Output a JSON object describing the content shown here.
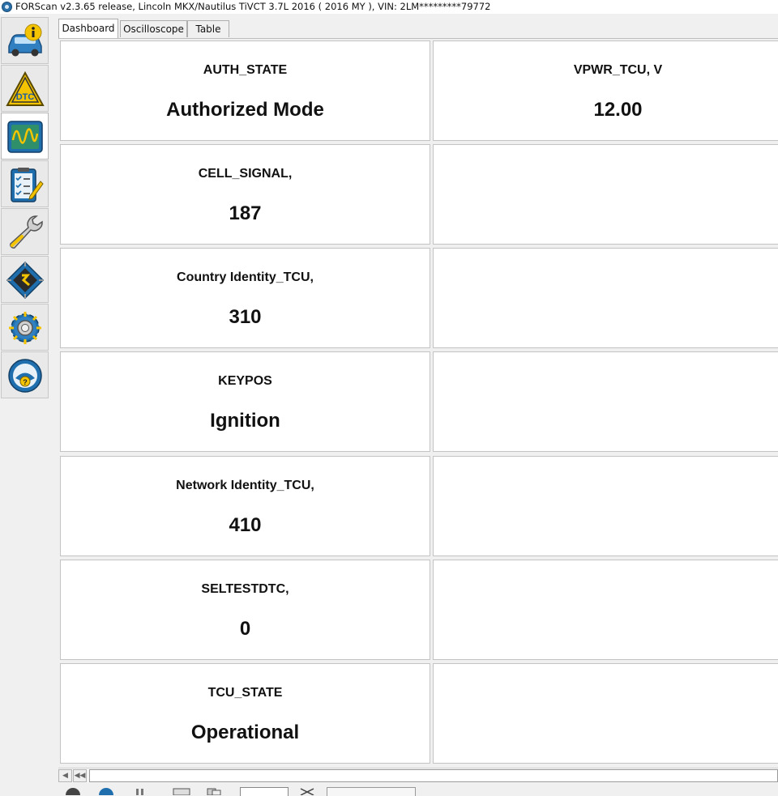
{
  "window": {
    "title": "FORScan v2.3.65 release, Lincoln MKX/Nautilus TiVCT 3.7L 2016 ( 2016 MY ), VIN: 2LM*********79772"
  },
  "sidebar": {
    "items": [
      {
        "icon": "vehicle-info-icon"
      },
      {
        "icon": "dtc-icon"
      },
      {
        "icon": "oscilloscope-icon"
      },
      {
        "icon": "checklist-icon"
      },
      {
        "icon": "wrench-icon"
      },
      {
        "icon": "chip-icon"
      },
      {
        "icon": "gear-icon"
      },
      {
        "icon": "help-icon"
      }
    ]
  },
  "tabs": [
    {
      "label": "Dashboard"
    },
    {
      "label": "Oscilloscope"
    },
    {
      "label": "Table"
    }
  ],
  "dashboard": {
    "tiles": [
      {
        "label": "AUTH_STATE",
        "value": "Authorized Mode"
      },
      {
        "label": "VPWR_TCU, V",
        "value": "12.00"
      },
      {
        "label": "CELL_SIGNAL,",
        "value": "187"
      },
      {
        "label": "Country Identity_TCU,",
        "value": "310"
      },
      {
        "label": "KEYPOS",
        "value": "Ignition"
      },
      {
        "label": "Network Identity_TCU,",
        "value": "410"
      },
      {
        "label": "SELTESTDTC,",
        "value": "0"
      },
      {
        "label": "TCU_STATE",
        "value": "Operational"
      }
    ]
  },
  "colors": {
    "accent_yellow": "#f5c400",
    "icon_blue": "#1f6fae",
    "scope_green": "#2f8f6a"
  }
}
